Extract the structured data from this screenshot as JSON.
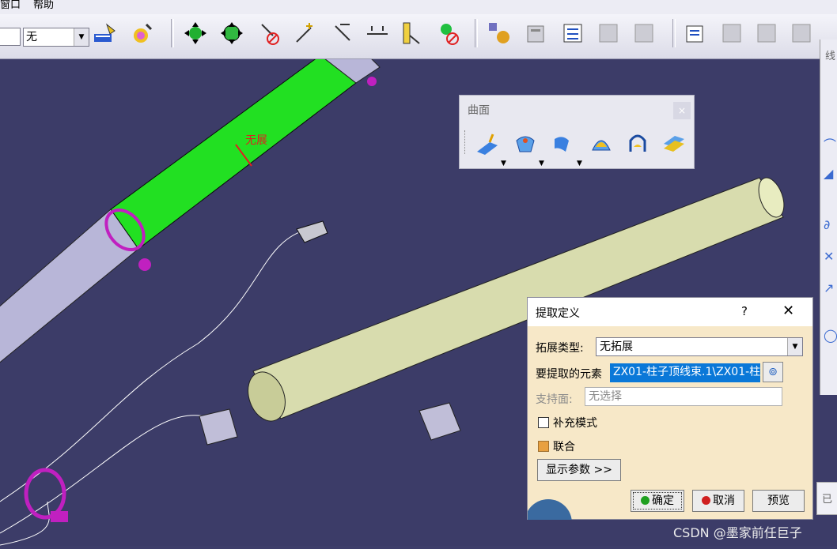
{
  "menubar": {
    "items": [
      "窗口",
      "帮助"
    ]
  },
  "toolbar": {
    "combo_value": "无",
    "icons": [
      "brush-icon",
      "paint-icon",
      "pan-icon",
      "rotate-icon",
      "hide-icon",
      "line-icon",
      "angle-icon",
      "distance-icon",
      "measure-icon",
      "cut-icon",
      "analysis-icon",
      "properties-icon",
      "grid-icon",
      "lock-icon",
      "tree-icon",
      "doc-icon",
      "snap-icon",
      "table-icon",
      "chart-icon"
    ]
  },
  "surface_toolbar": {
    "title": "曲面",
    "close": "×",
    "icons": [
      "extrude-surface-icon",
      "revolve-surface-icon",
      "offset-surface-icon",
      "sweep-surface-icon",
      "fill-surface-icon",
      "blend-surface-icon"
    ]
  },
  "viewport": {
    "annotation": "无展"
  },
  "right_panel": {
    "label": "线",
    "icons": [
      "curve-icon",
      "point-icon",
      "spline-icon",
      "helix-icon",
      "projection-icon",
      "circle-icon"
    ]
  },
  "bottom_panel": {
    "label": "已"
  },
  "dialog": {
    "title": "提取定义",
    "help": "?",
    "close": "✕",
    "extend_type_label": "拓展类型:",
    "extend_type_value": "无拓展",
    "element_label": "要提取的元素",
    "element_value": "ZX01-柱子顶线束.1\\ZX01-柱",
    "support_label": "支持面:",
    "support_placeholder": "无选择",
    "complement_label": "补充模式",
    "federation_label": "联合",
    "show_params_button": "显示参数 >>",
    "ok_button": "确定",
    "cancel_button": "取消",
    "preview_button": "预览"
  },
  "watermark": "CSDN @墨家前任巨子"
}
